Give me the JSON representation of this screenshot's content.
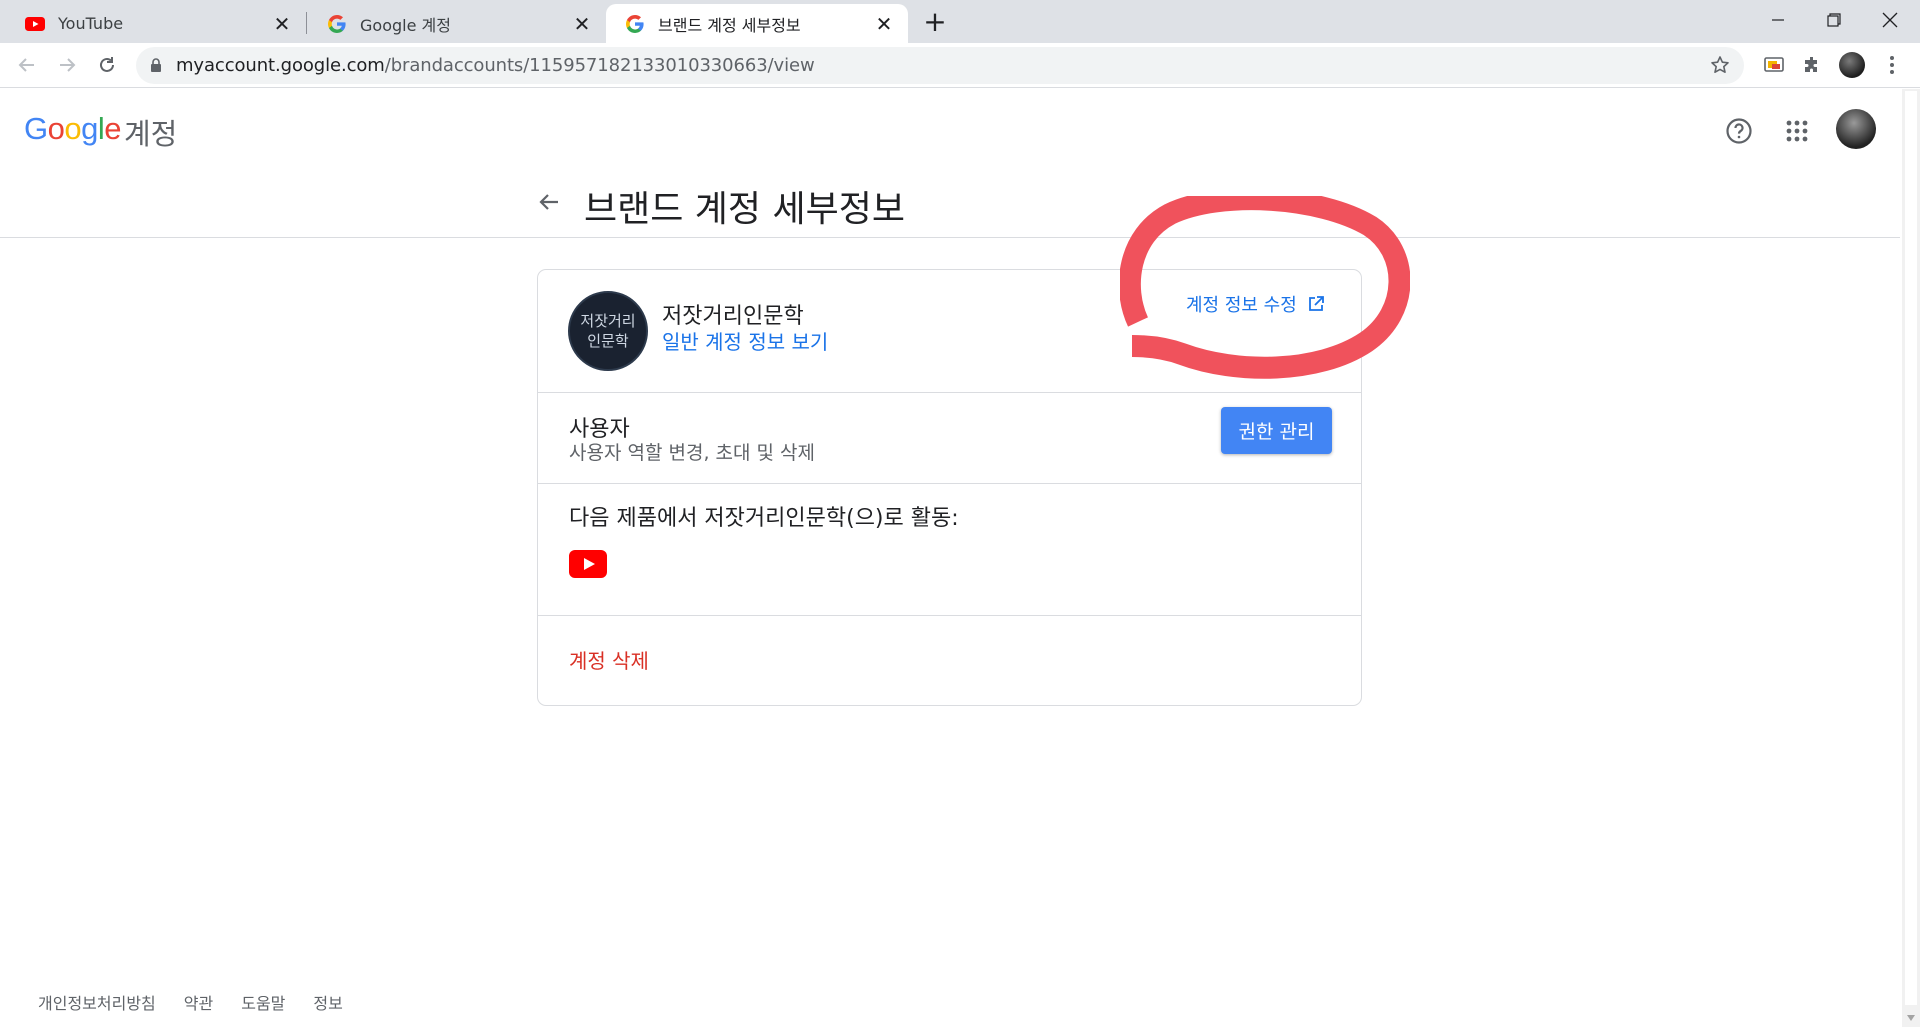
{
  "browser": {
    "tabs": [
      {
        "title": "YouTube",
        "icon": "youtube-icon"
      },
      {
        "title": "Google 계정",
        "icon": "google-g-icon"
      },
      {
        "title": "브랜드 계정 세부정보",
        "icon": "google-g-icon",
        "active": true
      }
    ],
    "url_domain": "myaccount.google.com",
    "url_path": "/brandaccounts/115957182133010330663/view"
  },
  "header": {
    "logo_letters": [
      "G",
      "o",
      "o",
      "g",
      "l",
      "e"
    ],
    "logo_suffix": "계정",
    "icons": [
      "help-icon",
      "apps-grid-icon",
      "account-avatar"
    ]
  },
  "page": {
    "title": "브랜드 계정 세부정보"
  },
  "brand": {
    "avatar_line1": "저잣거리",
    "avatar_line2": "인문학",
    "name": "저잣거리인문학",
    "view_link": "일반 계정 정보 보기",
    "edit_link": "계정 정보 수정"
  },
  "users": {
    "title": "사용자",
    "subtitle": "사용자 역할 변경, 초대 및 삭제",
    "button": "권한 관리"
  },
  "products": {
    "title": "다음 제품에서 저잣거리인문학(으)로 활동:",
    "items": [
      "youtube-icon"
    ]
  },
  "danger": {
    "delete_link": "계정 삭제"
  },
  "footer": {
    "links": [
      "개인정보처리방침",
      "약관",
      "도움말",
      "정보"
    ]
  },
  "colors": {
    "accent": "#1a73e8",
    "button": "#4285f4",
    "danger": "#d93025",
    "annotation": "#f0525c"
  }
}
